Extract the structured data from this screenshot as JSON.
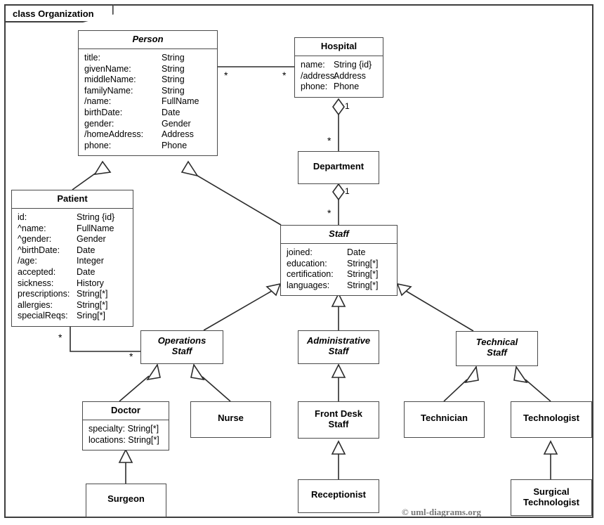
{
  "diagram": {
    "frame_label": "class Organization",
    "kind": "uml-class-diagram",
    "credit": "© uml-diagrams.org",
    "colors": {
      "background": "#ffffff",
      "frame_stroke": "#3d3d3d",
      "box_stroke": "#4a4a4a",
      "line_stroke": "#2b2b2b",
      "text": "#000000",
      "credit_text": "#777777"
    }
  },
  "classes": {
    "person": {
      "name": "Person",
      "abstract": true,
      "attributes": [
        {
          "key": "title:",
          "type": "String"
        },
        {
          "key": "givenName:",
          "type": "String"
        },
        {
          "key": "middleName:",
          "type": "String"
        },
        {
          "key": "familyName:",
          "type": "String"
        },
        {
          "key": "/name:",
          "type": "FullName"
        },
        {
          "key": "birthDate:",
          "type": "Date"
        },
        {
          "key": "gender:",
          "type": "Gender"
        },
        {
          "key": "/homeAddress:",
          "type": "Address"
        },
        {
          "key": "phone:",
          "type": "Phone"
        }
      ]
    },
    "hospital": {
      "name": "Hospital",
      "abstract": false,
      "attributes": [
        {
          "key": "name:",
          "type": "String {id}"
        },
        {
          "key": "/address:",
          "type": "Address"
        },
        {
          "key": "phone:",
          "type": "Phone"
        }
      ]
    },
    "department": {
      "name": "Department",
      "abstract": false,
      "attributes": []
    },
    "patient": {
      "name": "Patient",
      "abstract": false,
      "attributes": [
        {
          "key": "id:",
          "type": "String {id}"
        },
        {
          "key": "^name:",
          "type": "FullName"
        },
        {
          "key": "^gender:",
          "type": "Gender"
        },
        {
          "key": "^birthDate:",
          "type": "Date"
        },
        {
          "key": "/age:",
          "type": "Integer"
        },
        {
          "key": "accepted:",
          "type": "Date"
        },
        {
          "key": "sickness:",
          "type": "History"
        },
        {
          "key": "prescriptions:",
          "type": "String[*]"
        },
        {
          "key": "allergies:",
          "type": "String[*]"
        },
        {
          "key": "specialReqs:",
          "type": "Sring[*]"
        }
      ]
    },
    "staff": {
      "name": "Staff",
      "abstract": true,
      "attributes": [
        {
          "key": "joined:",
          "type": "Date"
        },
        {
          "key": "education:",
          "type": "String[*]"
        },
        {
          "key": "certification:",
          "type": "String[*]"
        },
        {
          "key": "languages:",
          "type": "String[*]"
        }
      ]
    },
    "operations_staff": {
      "name": "Operations\nStaff",
      "abstract": true,
      "attributes": []
    },
    "administrative_staff": {
      "name": "Administrative\nStaff",
      "abstract": true,
      "attributes": []
    },
    "technical_staff": {
      "name": "Technical\nStaff",
      "abstract": true,
      "attributes": []
    },
    "doctor": {
      "name": "Doctor",
      "abstract": false,
      "attributes": [
        {
          "key": "specialty: String[*]",
          "type": ""
        },
        {
          "key": "locations: String[*]",
          "type": ""
        }
      ]
    },
    "nurse": {
      "name": "Nurse",
      "abstract": false,
      "attributes": []
    },
    "front_desk_staff": {
      "name": "Front Desk\nStaff",
      "abstract": false,
      "attributes": []
    },
    "technician": {
      "name": "Technician",
      "abstract": false,
      "attributes": []
    },
    "technologist": {
      "name": "Technologist",
      "abstract": false,
      "attributes": []
    },
    "surgeon": {
      "name": "Surgeon",
      "abstract": false,
      "attributes": []
    },
    "receptionist": {
      "name": "Receptionist",
      "abstract": false,
      "attributes": []
    },
    "surgical_technologist": {
      "name": "Surgical\nTechnologist",
      "abstract": false,
      "attributes": []
    }
  },
  "relationships": [
    {
      "id": "person-hospital",
      "kind": "association",
      "source": "Person",
      "target": "Hospital",
      "source_multiplicity": "*",
      "target_multiplicity": "*"
    },
    {
      "id": "hospital-department",
      "kind": "composition",
      "source": "Hospital",
      "target": "Department",
      "source_multiplicity": "1",
      "target_multiplicity": "*"
    },
    {
      "id": "department-staff",
      "kind": "composition",
      "source": "Department",
      "target": "Staff",
      "source_multiplicity": "1",
      "target_multiplicity": "*"
    },
    {
      "id": "patient-operations-staff",
      "kind": "association",
      "source": "Patient",
      "target": "Operations Staff",
      "source_multiplicity": "*",
      "target_multiplicity": "*"
    },
    {
      "id": "patient-person",
      "kind": "generalization",
      "source": "Patient",
      "target": "Person"
    },
    {
      "id": "staff-person",
      "kind": "generalization",
      "source": "Staff",
      "target": "Person"
    },
    {
      "id": "operations-staff",
      "kind": "generalization",
      "source": "Operations Staff",
      "target": "Staff"
    },
    {
      "id": "administrative-staff",
      "kind": "generalization",
      "source": "Administrative Staff",
      "target": "Staff"
    },
    {
      "id": "technical-staff",
      "kind": "generalization",
      "source": "Technical Staff",
      "target": "Staff"
    },
    {
      "id": "doctor-operations",
      "kind": "generalization",
      "source": "Doctor",
      "target": "Operations Staff"
    },
    {
      "id": "nurse-operations",
      "kind": "generalization",
      "source": "Nurse",
      "target": "Operations Staff"
    },
    {
      "id": "frontdesk-administrative",
      "kind": "generalization",
      "source": "Front Desk Staff",
      "target": "Administrative Staff"
    },
    {
      "id": "technician-technical",
      "kind": "generalization",
      "source": "Technician",
      "target": "Technical Staff"
    },
    {
      "id": "technologist-technical",
      "kind": "generalization",
      "source": "Technologist",
      "target": "Technical Staff"
    },
    {
      "id": "surgeon-doctor",
      "kind": "generalization",
      "source": "Surgeon",
      "target": "Doctor"
    },
    {
      "id": "receptionist-frontdesk",
      "kind": "generalization",
      "source": "Receptionist",
      "target": "Front Desk Staff"
    },
    {
      "id": "surgicaltech-technologist",
      "kind": "generalization",
      "source": "Surgical Technologist",
      "target": "Technologist"
    }
  ],
  "multiplicity_labels": {
    "person_to_hospital": "*",
    "hospital_to_person": "*",
    "hospital_one": "1",
    "department_many": "*",
    "department_one": "1",
    "staff_many": "*",
    "patient_many": "*",
    "operations_many": "*"
  }
}
